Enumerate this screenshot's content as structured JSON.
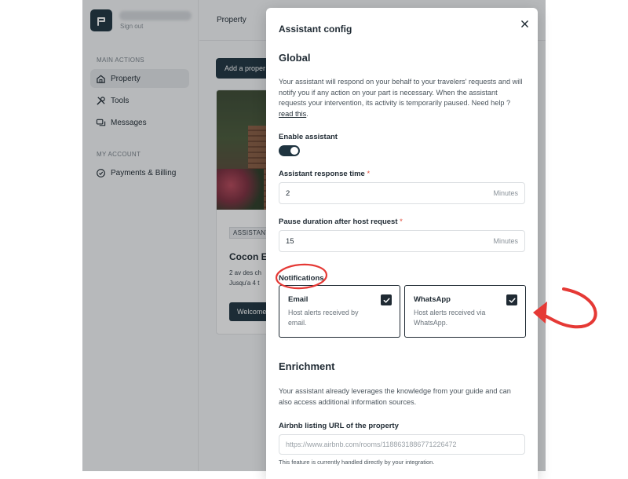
{
  "sidebar": {
    "signout": "Sign out",
    "section_main": "MAIN ACTIONS",
    "section_account": "MY ACCOUNT",
    "items": [
      {
        "label": "Property",
        "icon": "home-icon"
      },
      {
        "label": "Tools",
        "icon": "tools-icon"
      },
      {
        "label": "Messages",
        "icon": "messages-icon"
      },
      {
        "label": "Payments & Billing",
        "icon": "billing-icon"
      }
    ]
  },
  "topbar": {
    "title": "Property"
  },
  "main": {
    "add_button": "Add a proper",
    "card": {
      "tag": "ASSISTANT",
      "title": "Cocon E",
      "address": "2 av des ch",
      "capacity": "Jusqu'a 4 t",
      "welcome_button": "Welcome"
    }
  },
  "modal": {
    "title": "Assistant config",
    "close_icon": "close-icon",
    "global": {
      "heading": "Global",
      "description": "Your assistant will respond on your behalf to your travelers' requests and will notify you if any action on your part is necessary. When the assistant requests your intervention, its activity is temporarily paused. Need help ?",
      "help_link": "read this",
      "help_suffix": "."
    },
    "enable_assistant": {
      "label": "Enable assistant",
      "enabled": true
    },
    "response_time": {
      "label": "Assistant response time",
      "required": "*",
      "value": "2",
      "unit": "Minutes"
    },
    "pause_duration": {
      "label": "Pause duration after host request",
      "required": "*",
      "value": "15",
      "unit": "Minutes"
    },
    "notifications": {
      "label": "Notifications",
      "options": [
        {
          "title": "Email",
          "description": "Host alerts received by email.",
          "checked": true
        },
        {
          "title": "WhatsApp",
          "description": "Host alerts received via WhatsApp.",
          "checked": true
        }
      ]
    },
    "enrichment": {
      "heading": "Enrichment",
      "description": "Your assistant already leverages the knowledge from your guide and can also access additional information sources.",
      "airbnb_label": "Airbnb listing URL of the property",
      "airbnb_placeholder": "https://www.airbnb.com/rooms/1188631886771226472",
      "hint": "This feature is currently handled directly by your integration."
    }
  },
  "colors": {
    "primary": "#1f3440",
    "annotation": "#e53935",
    "required": "#e04b3a",
    "overlay": "rgba(20,25,30,0.28)"
  }
}
